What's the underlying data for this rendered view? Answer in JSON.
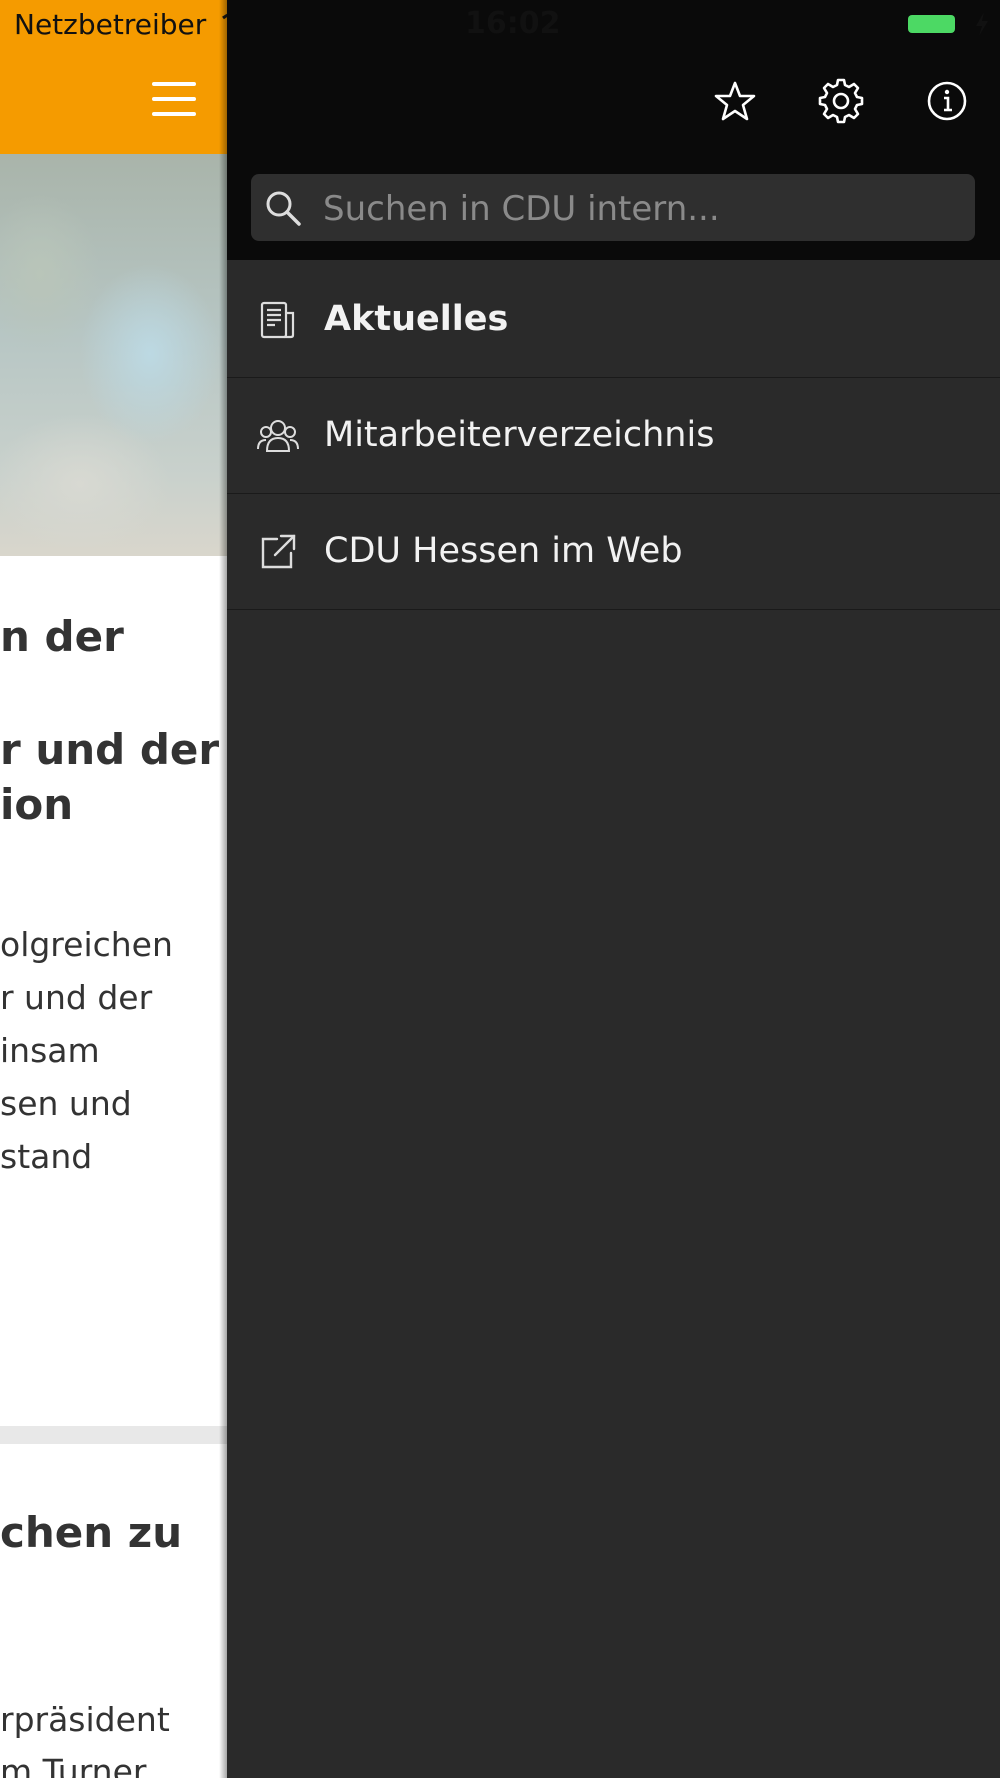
{
  "status_bar": {
    "carrier": "Netzbetreiber",
    "time": "16:02",
    "battery_color": "#4cd964"
  },
  "header": {
    "brand_color": "#f59b00",
    "menu_icon": "hamburger-icon"
  },
  "article": {
    "heading_lines": [
      "n der",
      "r und der",
      "ion"
    ],
    "body_lines": [
      "olgreichen",
      "r und der",
      "insam",
      "sen und",
      "stand"
    ],
    "second_heading": "chen zu",
    "second_body_lines": [
      "rpräsident",
      "m Turner"
    ]
  },
  "drawer": {
    "toolbar_icons": [
      "star-icon",
      "gear-icon",
      "info-icon"
    ],
    "search": {
      "placeholder": "Suchen in CDU intern...",
      "value": ""
    },
    "menu": [
      {
        "label": "Aktuelles",
        "icon": "newspaper-icon",
        "active": true
      },
      {
        "label": "Mitarbeiterverzeichnis",
        "icon": "people-icon",
        "active": false
      },
      {
        "label": "CDU Hessen im Web",
        "icon": "external-link-icon",
        "active": false
      }
    ]
  }
}
